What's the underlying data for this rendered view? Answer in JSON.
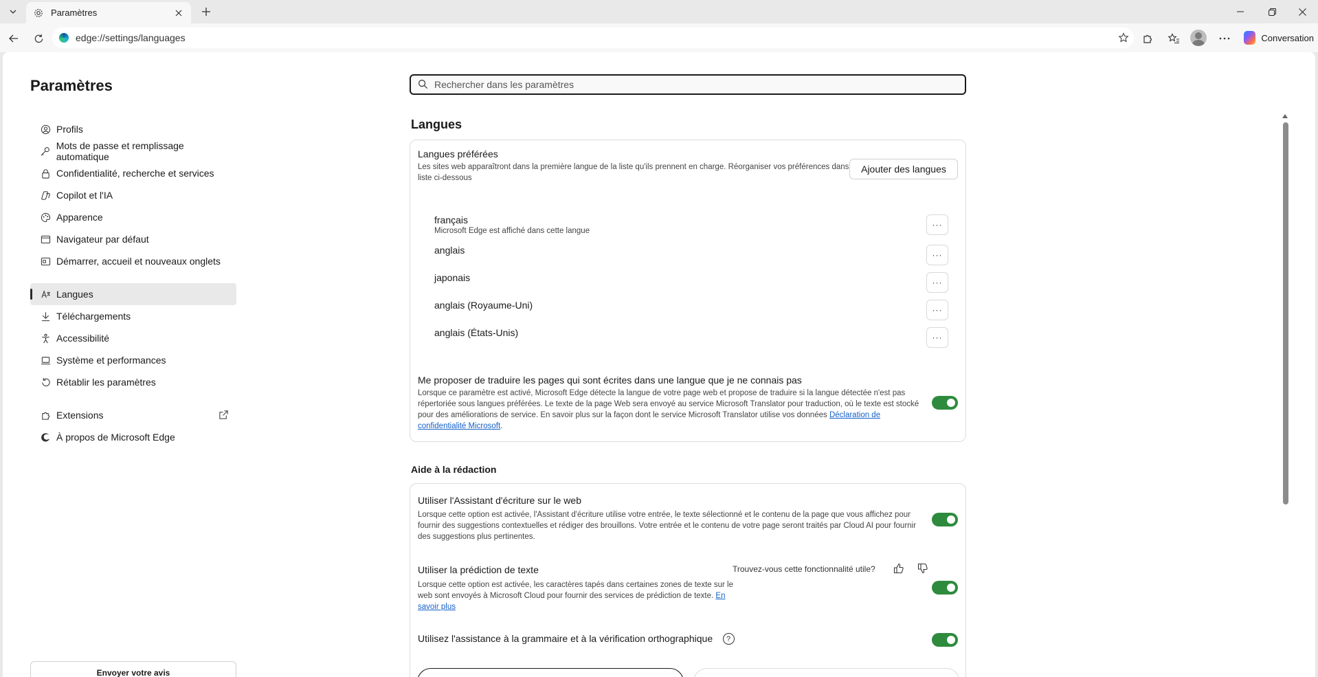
{
  "tab": {
    "title": "Paramètres"
  },
  "address": {
    "url": "edge://settings/languages"
  },
  "toolbar": {
    "conversation_label": "Conversation"
  },
  "sidebar": {
    "title": "Paramètres",
    "items": [
      {
        "label": "Profils",
        "icon": "profile-icon"
      },
      {
        "label": "Mots de passe et remplissage automatique",
        "icon": "key-icon"
      },
      {
        "label": "Confidentialité, recherche et services",
        "icon": "lock-icon"
      },
      {
        "label": "Copilot et l'IA",
        "icon": "copilot-icon"
      },
      {
        "label": "Apparence",
        "icon": "palette-icon"
      },
      {
        "label": "Navigateur par défaut",
        "icon": "browser-icon"
      },
      {
        "label": "Démarrer, accueil et nouveaux onglets",
        "icon": "home-icon"
      },
      {
        "label": "Langues",
        "icon": "languages-icon"
      },
      {
        "label": "Téléchargements",
        "icon": "download-icon"
      },
      {
        "label": "Accessibilité",
        "icon": "accessibility-icon"
      },
      {
        "label": "Système et performances",
        "icon": "laptop-icon"
      },
      {
        "label": "Rétablir les paramètres",
        "icon": "reset-icon"
      },
      {
        "label": "Extensions",
        "icon": "extensions-icon"
      },
      {
        "label": "À propos de Microsoft Edge",
        "icon": "edge-icon"
      }
    ],
    "active_item": "Langues",
    "feedback_label": "Envoyer votre avis"
  },
  "search": {
    "placeholder": "Rechercher dans les paramètres"
  },
  "languages": {
    "title": "Langues",
    "preferred_title": "Langues préférées",
    "preferred_desc": "Les sites web apparaîtront dans la première langue de la liste qu'ils prennent en charge. Réorganiser vos préférences dans la liste ci-dessous",
    "add_button": "Ajouter des langues",
    "list": [
      {
        "name": "français",
        "note": "Microsoft Edge est affiché dans cette langue"
      },
      {
        "name": "anglais",
        "note": ""
      },
      {
        "name": "japonais",
        "note": ""
      },
      {
        "name": "anglais (Royaume-Uni)",
        "note": ""
      },
      {
        "name": "anglais (États-Unis)",
        "note": ""
      }
    ],
    "more_label": "···",
    "translate_title": "Me proposer de traduire les pages qui sont écrites dans une langue que je ne connais pas",
    "translate_desc": "Lorsque ce paramètre est activé, Microsoft Edge détecte la langue de votre page web et propose de traduire si la langue détectée n'est pas répertoriée sous langues préférées. Le texte de la page Web sera envoyé au service Microsoft Translator pour traduction, où le texte est stocké pour des améliorations de service. En savoir plus sur la façon dont le service Microsoft Translator utilise vos données",
    "translate_link": "Déclaration de confidentialité Microsoft",
    "translate_enabled": true
  },
  "writing": {
    "title": "Aide à la rédaction",
    "assistant_title": "Utiliser l'Assistant d'écriture sur le web",
    "assistant_desc": "Lorsque cette option est activée, l'Assistant d'écriture utilise votre entrée, le texte sélectionné et le contenu de la page que vous affichez pour fournir des suggestions contextuelles et rédiger des brouillons. Votre entrée et le contenu de votre page seront traités par Cloud AI pour fournir des suggestions plus pertinentes.",
    "assistant_enabled": true,
    "prediction_title": "Utiliser la prédiction de texte",
    "prediction_feedback": "Trouvez-vous cette fonctionnalité utile?",
    "prediction_desc": "Lorsque cette option est activée, les caractères tapés dans certaines zones de texte sur le web sont envoyés à Microsoft Cloud pour fournir des services de prédiction de texte.",
    "prediction_link": "En savoir plus",
    "prediction_enabled": true,
    "grammar_title": "Utilisez l'assistance à la grammaire et à la vérification orthographique",
    "grammar_help": "?",
    "grammar_enabled": true
  }
}
